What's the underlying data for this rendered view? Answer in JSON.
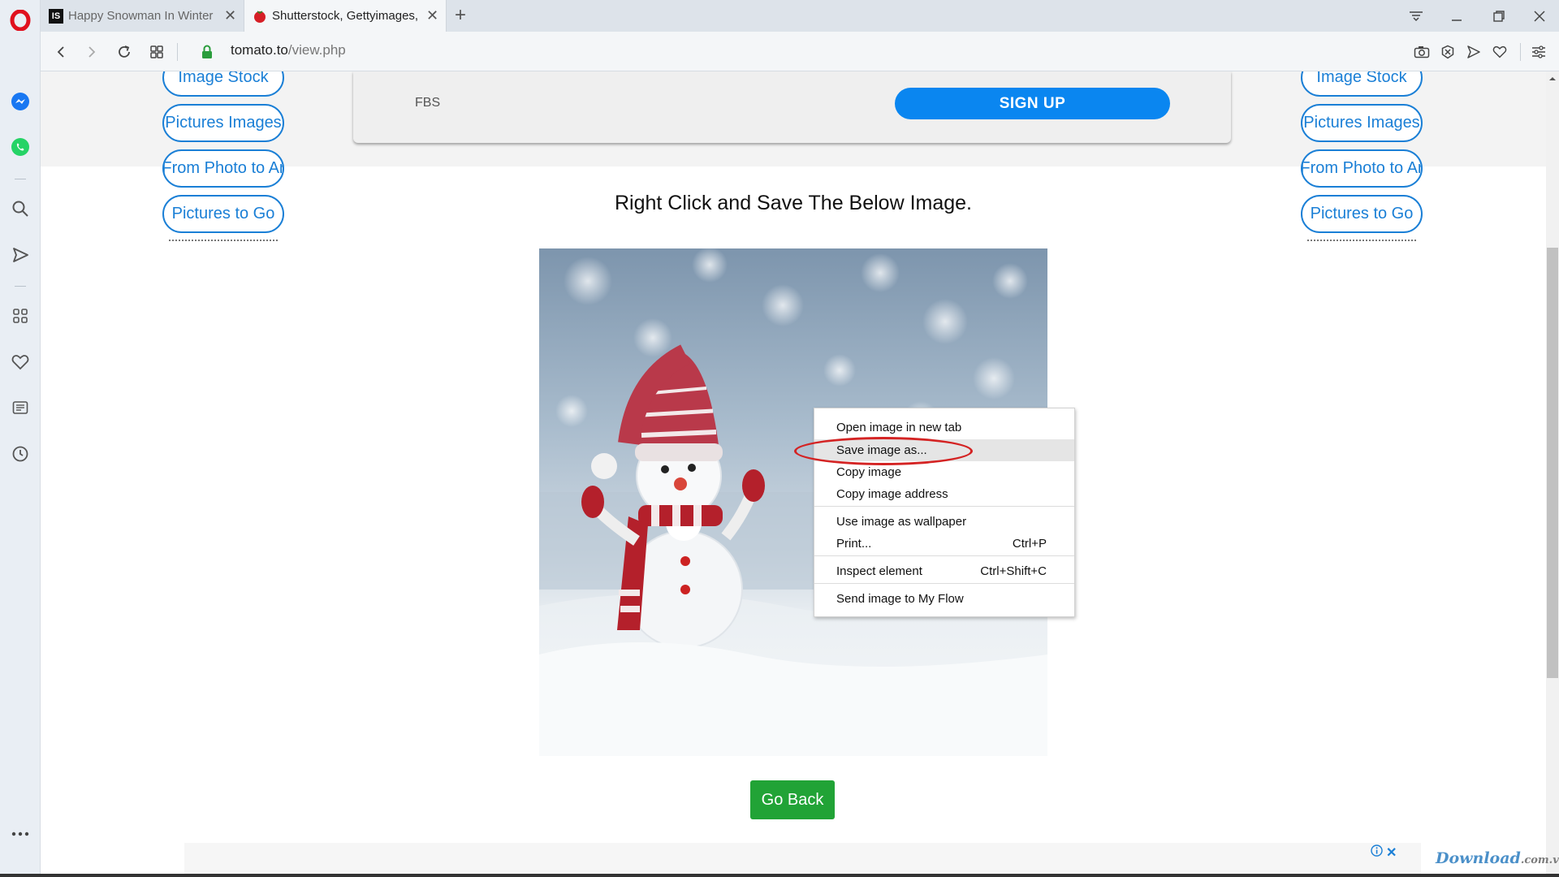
{
  "browser": {
    "tabs": [
      {
        "favicon_text": "IS",
        "label": "Happy Snowman In Winter",
        "active": false
      },
      {
        "label": "Shutterstock, Gettyimages,",
        "active": true
      }
    ],
    "url": {
      "host": "tomato.to",
      "path": "/view.php"
    }
  },
  "ad_top": {
    "sponsor": "FBS",
    "cta": "SIGN UP"
  },
  "side_menu_left": [
    "Image Stock",
    "Pictures Images",
    "From Photo to Ar",
    "Pictures to Go"
  ],
  "side_menu_right": [
    "Image Stock",
    "Pictures Images",
    "From Photo to Ar",
    "Pictures to Go"
  ],
  "main": {
    "heading": "Right Click and Save The Below Image.",
    "go_back": "Go Back"
  },
  "context_menu": {
    "items": [
      {
        "label": "Open image in new tab",
        "shortcut": ""
      },
      {
        "label": "Save image as...",
        "shortcut": ""
      },
      {
        "label": "Copy image",
        "shortcut": ""
      },
      {
        "label": "Copy image address",
        "shortcut": ""
      },
      {
        "label": "Use image as wallpaper",
        "shortcut": ""
      },
      {
        "label": "Print...",
        "shortcut": "Ctrl+P"
      },
      {
        "label": "Inspect element",
        "shortcut": "Ctrl+Shift+C"
      },
      {
        "label": "Send image to My Flow",
        "shortcut": ""
      }
    ],
    "highlighted_label": "Save image as..."
  },
  "ad_bottom": {
    "close": "✕"
  },
  "watermark": {
    "brand": "Download",
    "suffix": ".com.vn"
  },
  "colors": {
    "accent_blue": "#1a7fd6",
    "signup_blue": "#0a86f0",
    "go_back_green": "#21a336",
    "annotation_red": "#d42323",
    "opera_red": "#e0101e"
  },
  "icons": {
    "sidebar": [
      "opera-logo-icon",
      "messenger-icon",
      "whatsapp-icon",
      "search-icon",
      "send-icon",
      "grid-icon",
      "heart-icon",
      "news-icon",
      "history-icon",
      "more-icon"
    ],
    "toolbar": [
      "back-icon",
      "forward-icon",
      "reload-icon",
      "speed-dial-icon",
      "lock-icon",
      "camera-icon",
      "adblock-icon",
      "flow-icon",
      "bookmark-heart-icon",
      "easy-setup-icon"
    ]
  }
}
